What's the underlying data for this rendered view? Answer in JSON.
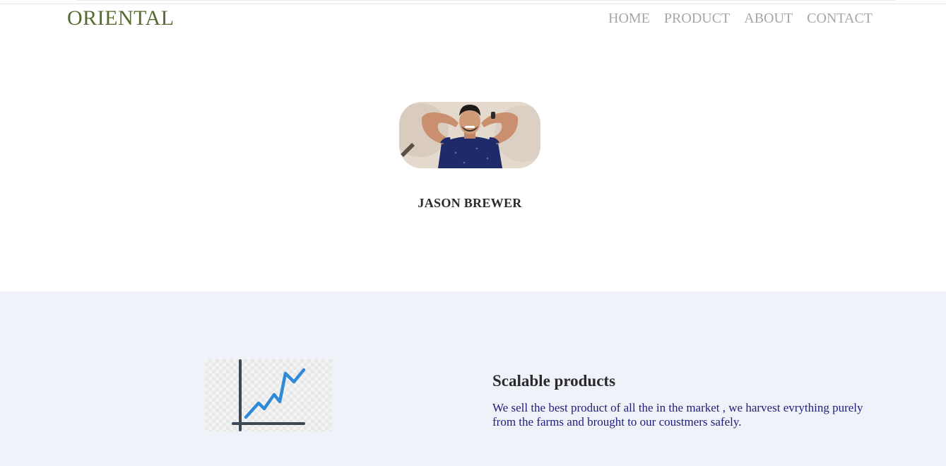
{
  "header": {
    "brand": "ORIENTAL",
    "nav": [
      "HOME",
      "PRODUCT",
      "ABOUT",
      "CONTACT"
    ]
  },
  "profile": {
    "name": "JASON BREWER",
    "photo_alt": "profile photo of smiling man in navy t-shirt"
  },
  "feature": {
    "icon": "line-chart-growth-icon",
    "title": "Scalable products",
    "description": "We sell the best product of all the in the market , we harvest evrything purely from the farms and brought to our coustmers safely."
  },
  "colors": {
    "brand": "#556b2f",
    "nav": "#a6a6a6",
    "feature_bg": "#eff2f9",
    "feature_text": "#1d1d7a",
    "chart_axis": "#3d4a55",
    "chart_line": "#2f8ad8"
  }
}
